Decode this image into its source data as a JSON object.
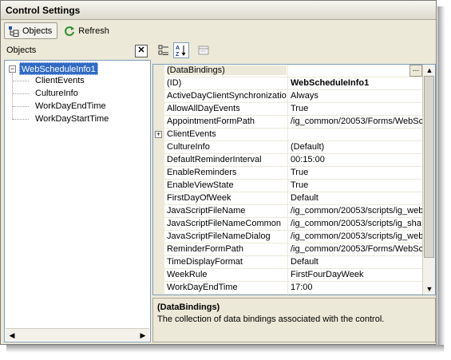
{
  "window": {
    "title": "Control Settings"
  },
  "tabs": [
    {
      "label": "Objects",
      "icon": "objects-tree-icon",
      "active": true
    },
    {
      "label": "Refresh",
      "icon": "refresh-icon",
      "active": false
    }
  ],
  "left_pane": {
    "label": "Objects",
    "close_glyph": "✕",
    "tree": {
      "root": "WebScheduleInfo1",
      "children": [
        "ClientEvents",
        "CultureInfo",
        "WorkDayEndTime",
        "WorkDayStartTime"
      ]
    }
  },
  "toolbar": [
    {
      "name": "categorized-icon",
      "active": false
    },
    {
      "name": "alphabetical-icon",
      "active": true
    },
    {
      "name": "property-pages-icon",
      "active": false
    }
  ],
  "properties": [
    {
      "name": "(DataBindings)",
      "value": "",
      "selected": true,
      "has_ellipsis": true
    },
    {
      "name": "(ID)",
      "value": "WebScheduleInfo1",
      "bold": true
    },
    {
      "name": "ActiveDayClientSynchronization",
      "value": "Always"
    },
    {
      "name": "AllowAllDayEvents",
      "value": "True"
    },
    {
      "name": "AppointmentFormPath",
      "value": "/ig_common/20053/Forms/WebSc"
    },
    {
      "name": "ClientEvents",
      "value": "",
      "expandable": true
    },
    {
      "name": "CultureInfo",
      "value": "(Default)"
    },
    {
      "name": "DefaultReminderInterval",
      "value": "00:15:00"
    },
    {
      "name": "EnableReminders",
      "value": "True"
    },
    {
      "name": "EnableViewState",
      "value": "True"
    },
    {
      "name": "FirstDayOfWeek",
      "value": "Default"
    },
    {
      "name": "JavaScriptFileName",
      "value": "/ig_common/20053/scripts/ig_web"
    },
    {
      "name": "JavaScriptFileNameCommon",
      "value": "/ig_common/20053/scripts/ig_sha"
    },
    {
      "name": "JavaScriptFileNameDialog",
      "value": "/ig_common/20053/scripts/ig_web"
    },
    {
      "name": "ReminderFormPath",
      "value": "/ig_common/20053/Forms/WebSc"
    },
    {
      "name": "TimeDisplayFormat",
      "value": "Default"
    },
    {
      "name": "WeekRule",
      "value": "FirstFourDayWeek"
    },
    {
      "name": "WorkDayEndTime",
      "value": "17:00"
    }
  ],
  "description": {
    "title": "(DataBindings)",
    "text": "The collection of data bindings associated with the control."
  }
}
